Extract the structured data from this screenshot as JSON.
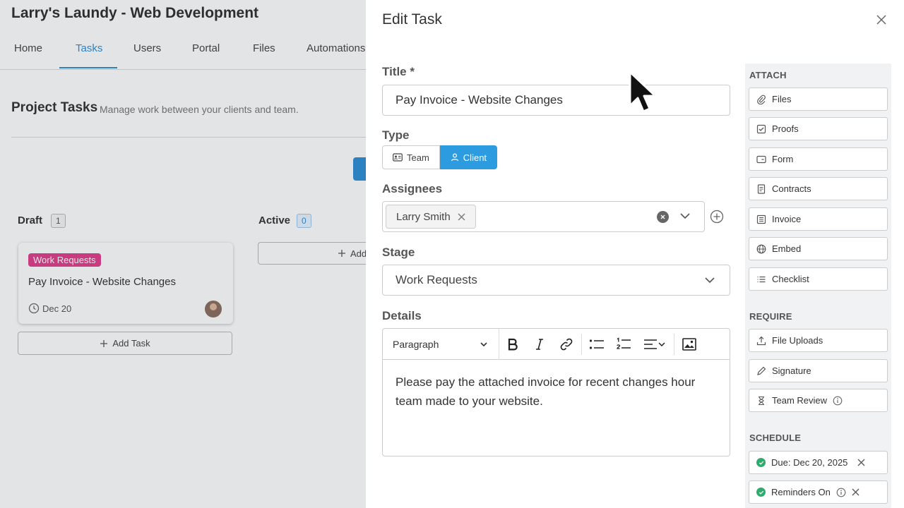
{
  "app": {
    "title": "Larry's Laundy - Web Development",
    "nav_tabs": [
      "Home",
      "Tasks",
      "Users",
      "Portal",
      "Files",
      "Automations"
    ],
    "active_tab": "Tasks"
  },
  "project": {
    "title": "Project Tasks",
    "subtitle": "Manage work between your clients and team."
  },
  "board": {
    "columns": [
      {
        "name": "Draft",
        "count": "1"
      },
      {
        "name": "Active",
        "count": "0"
      }
    ],
    "card": {
      "tag": "Work Requests",
      "title": "Pay Invoice - Website Changes",
      "date": "Dec 20"
    },
    "add_task_label": "Add Task",
    "active_add_label": "Add"
  },
  "edit_task": {
    "heading": "Edit Task",
    "title_label": "Title *",
    "title_value": "Pay Invoice - Website Changes",
    "type_label": "Type",
    "type_options": [
      "Team",
      "Client"
    ],
    "type_selected": "Client",
    "assignees_label": "Assignees",
    "assignees": [
      "Larry Smith"
    ],
    "stage_label": "Stage",
    "stage_value": "Work Requests",
    "details_label": "Details",
    "editor": {
      "block_format": "Paragraph",
      "content": "Please pay the attached invoice for recent changes hour team made to your website."
    }
  },
  "sidebar": {
    "attach_heading": "ATTACH",
    "attach_items": [
      "Files",
      "Proofs",
      "Form",
      "Contracts",
      "Invoice",
      "Embed",
      "Checklist"
    ],
    "require_heading": "REQUIRE",
    "require_items": [
      "File Uploads",
      "Signature",
      "Team Review"
    ],
    "schedule_heading": "SCHEDULE",
    "schedule_items": [
      "Due: Dec 20, 2025",
      "Reminders On"
    ]
  },
  "colors": {
    "accent": "#2d9be0",
    "tag": "#e23d8a",
    "success": "#2eab6e"
  }
}
